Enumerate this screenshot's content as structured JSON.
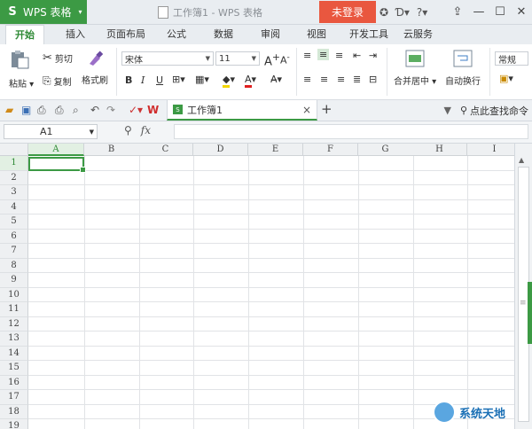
{
  "app": {
    "logo": "S",
    "name": "WPS 表格",
    "menu_arrow": "▾"
  },
  "window": {
    "title": "工作簿1 - WPS 表格",
    "login": "未登录",
    "help": "?"
  },
  "menu_tabs": [
    "开始",
    "插入",
    "页面布局",
    "公式",
    "数据",
    "审阅",
    "视图",
    "开发工具",
    "云服务"
  ],
  "ribbon": {
    "paste": "粘贴",
    "cut": "剪切",
    "copy": "复制",
    "format_painter": "格式刷",
    "font_name": "宋体",
    "font_size": "11",
    "bold": "B",
    "italic": "I",
    "underline": "U",
    "grow": "A",
    "shrink": "A",
    "merge_center": "合并居中",
    "wrap_text": "自动换行",
    "number_format": "常规"
  },
  "doc_tab": {
    "name": "工作簿1",
    "close": "×",
    "new": "+"
  },
  "search_command": "点此查找命令",
  "formula_bar": {
    "name_box": "A1",
    "fx": "fx",
    "value": ""
  },
  "grid": {
    "columns": [
      "A",
      "B",
      "C",
      "D",
      "E",
      "F",
      "G",
      "H",
      "I"
    ],
    "rows": [
      "1",
      "2",
      "3",
      "4",
      "5",
      "6",
      "7",
      "8",
      "9",
      "10",
      "11",
      "12",
      "13",
      "14",
      "15",
      "16",
      "17",
      "18",
      "19"
    ],
    "active_cell": "A1"
  },
  "watermark": "系统天地",
  "colors": {
    "accent": "#3c9a44",
    "login": "#e9573f"
  }
}
